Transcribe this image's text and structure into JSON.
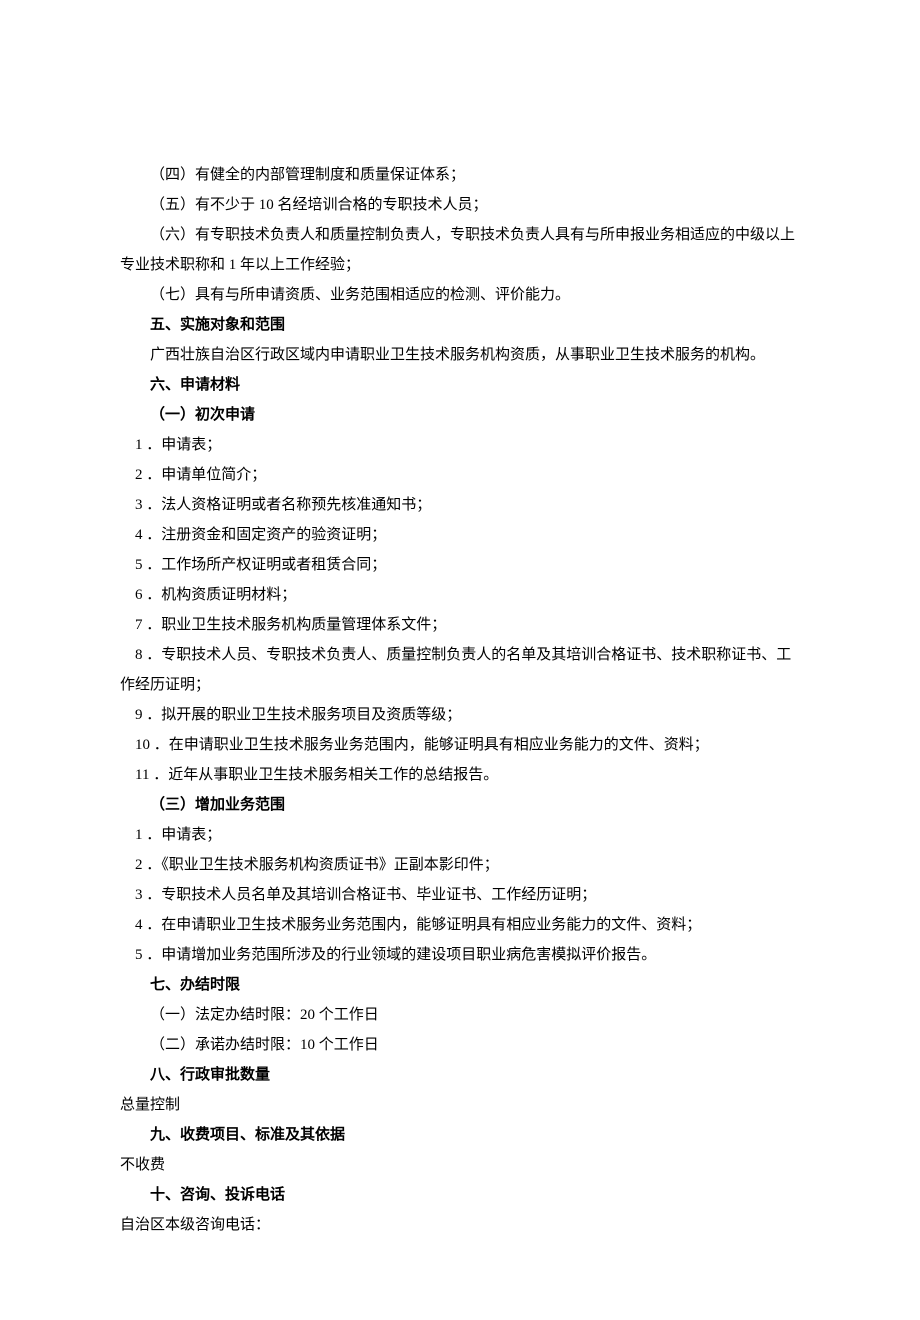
{
  "lines": [
    {
      "text": "（四）有健全的内部管理制度和质量保证体系；",
      "cls": ""
    },
    {
      "text": "（五）有不少于 10 名经培训合格的专职技术人员；",
      "cls": ""
    },
    {
      "text": "（六）有专职技术负责人和质量控制负责人，专职技术负责人具有与所申报业务相适应的中级以上专业技术职称和 1 年以上工作经验；",
      "cls": ""
    },
    {
      "text": "（七）具有与所申请资质、业务范围相适应的检测、评价能力。",
      "cls": ""
    },
    {
      "text": "五、实施对象和范围",
      "cls": "bold"
    },
    {
      "text": "广西壮族自治区行政区域内申请职业卫生技术服务机构资质，从事职业卫生技术服务的机构。",
      "cls": ""
    },
    {
      "text": "六、申请材料",
      "cls": "bold"
    },
    {
      "text": "（一）初次申请",
      "cls": "bold"
    },
    {
      "text": "1 ．申请表；",
      "cls": "list-item"
    },
    {
      "text": "2 ．申请单位简介；",
      "cls": "list-item"
    },
    {
      "text": "3 ．法人资格证明或者名称预先核准通知书；",
      "cls": "list-item"
    },
    {
      "text": "4 ．注册资金和固定资产的验资证明；",
      "cls": "list-item"
    },
    {
      "text": "5 ．工作场所产权证明或者租赁合同；",
      "cls": "list-item"
    },
    {
      "text": "6 ．机构资质证明材料；",
      "cls": "list-item"
    },
    {
      "text": "7 ．职业卫生技术服务机构质量管理体系文件；",
      "cls": "list-item"
    },
    {
      "text": "8 ．专职技术人员、专职技术负责人、质量控制负责人的名单及其培训合格证书、技术职称证书、工作经历证明；",
      "cls": "list-item"
    },
    {
      "text": "9 ．拟开展的职业卫生技术服务项目及资质等级；",
      "cls": "list-item"
    },
    {
      "text": "10 ．在申请职业卫生技术服务业务范围内，能够证明具有相应业务能力的文件、资料；",
      "cls": "list-item"
    },
    {
      "text": "11 ．近年从事职业卫生技术服务相关工作的总结报告。",
      "cls": "list-item"
    },
    {
      "text": "（三）增加业务范围",
      "cls": "bold"
    },
    {
      "text": "1 ．申请表；",
      "cls": "list-item"
    },
    {
      "text": "2 ．《职业卫生技术服务机构资质证书》正副本影印件；",
      "cls": "list-item"
    },
    {
      "text": "3 ．专职技术人员名单及其培训合格证书、毕业证书、工作经历证明；",
      "cls": "list-item"
    },
    {
      "text": "4 ．在申请职业卫生技术服务业务范围内，能够证明具有相应业务能力的文件、资料；",
      "cls": "list-item"
    },
    {
      "text": "5 ．申请增加业务范围所涉及的行业领域的建设项目职业病危害模拟评价报告。",
      "cls": "list-item"
    },
    {
      "text": "七、办结时限",
      "cls": "bold"
    },
    {
      "text": "（一）法定办结时限：20 个工作日",
      "cls": ""
    },
    {
      "text": "（二）承诺办结时限：10 个工作日",
      "cls": ""
    },
    {
      "text": "八、行政审批数量",
      "cls": "bold"
    },
    {
      "text": "总量控制",
      "cls": "no-indent"
    },
    {
      "text": "九、收费项目、标准及其依据",
      "cls": "bold"
    },
    {
      "text": "不收费",
      "cls": "no-indent"
    },
    {
      "text": "十、咨询、投诉电话",
      "cls": "bold"
    },
    {
      "text": "自治区本级咨询电话：",
      "cls": "no-indent"
    }
  ]
}
